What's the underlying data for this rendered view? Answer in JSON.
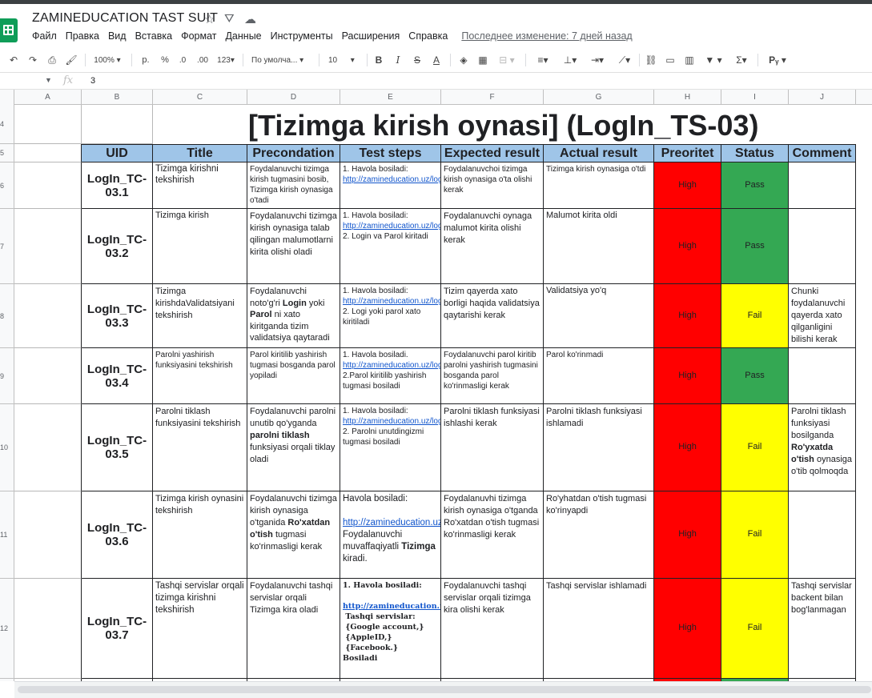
{
  "app": {
    "doc_title": "ZAMINEDUCATION TAST SUIT",
    "menu": [
      "Файл",
      "Правка",
      "Вид",
      "Вставка",
      "Формат",
      "Данные",
      "Инструменты",
      "Расширения",
      "Справка"
    ],
    "last_edit": "Последнее изменение: 7 дней назад"
  },
  "toolbar": {
    "zoom": "100%",
    "currency": "р.",
    "percent": "%",
    "dec_less": ".0",
    "dec_more": ".00",
    "format_123": "123",
    "font": "По умолча...",
    "font_size": "10"
  },
  "formula": {
    "value": "3"
  },
  "columns": [
    "A",
    "B",
    "C",
    "D",
    "E",
    "F",
    "G",
    "H",
    "I",
    "J"
  ],
  "row_numbers": [
    "4",
    "5",
    "6",
    "7",
    "8",
    "9",
    "10",
    "11",
    "12"
  ],
  "sheet": {
    "title": "[Tizimga kirish oynasi] (LogIn_TS-03)",
    "headers": [
      "UID",
      "Title",
      "Precondation",
      "Test steps",
      "Expected result",
      "Actual result",
      "Preoritet",
      "Status",
      "Comment"
    ],
    "rows": [
      {
        "uid": "LogIn_TC-03.1",
        "title": "Tizimga kirishni tekshirish",
        "pre": "Foydalanuvchi tizimga kirish tugmasini bosib, Tizimga kirish oynasiga o'tadi",
        "steps_a": "1. Havola bosiladi: ",
        "link": "http://zamineducation.uz/login",
        "steps_b": "",
        "expected": "Foydalanuvchoi tizimga kirish oynasiga o'ta olishi kerak",
        "actual": "Tizimga kirish oynasiga o'tdi",
        "priority": "High",
        "status": "Pass",
        "comment": ""
      },
      {
        "uid": "LogIn_TC-03.2",
        "title": "Tizimga kirish",
        "pre": "Foydalanuvchi tizimga kirish oynasiga talab qilingan malumotlarni kirita olishi oladi",
        "steps_a": "1. Havola bosiladi: ",
        "link": "http://zamineducation.uz/login",
        "steps_b": "2. Login va Parol kiritadi",
        "expected": "Foydalanuvchi oynaga malumot kirita olishi kerak",
        "actual": "Malumot kirita oldi",
        "priority": "High",
        "status": "Pass",
        "comment": ""
      },
      {
        "uid": "LogIn_TC-03.3",
        "title": "Tizimga kirishdaValidatsiyani tekshirish",
        "pre_a": "Foydalanuvchi noto'g'ri ",
        "pre_b1": "Login",
        "pre_c": " yoki ",
        "pre_b2": "Parol",
        "pre_d": " ni xato kiritganda tizim validatsiya qaytaradi",
        "steps_a": "1. Havola bosiladi: ",
        "link": "http://zamineducation.uz/login",
        "steps_b": "2. Logi yoki parol xato kiritiladi",
        "expected": "Tizim qayerda xato borligi haqida validatsiya qaytarishi kerak",
        "actual": "Validatsiya yo'q",
        "priority": "High",
        "status": "Fail",
        "comment": "Chunki foydalanuvchi qayerda xato qilganligini bilishi kerak"
      },
      {
        "uid": "LogIn_TC-03.4",
        "title": "Parolni yashirish funksiyasini tekshirish",
        "pre": "Parol kiritilib yashirish tugmasi bosganda parol yopiladi",
        "steps_a": " 1. Havola bosiladi. ",
        "link": "http://zamineducation.uz/login",
        "steps_b": "2.Parol kiritilib yashirish tugmasi bosiladi",
        "expected": "Foydalanuvchi parol kiritib parolni yashirish tugmasini bosganda parol ko'rinmasligi kerak",
        "actual": "Parol ko'rinmadi",
        "priority": "High",
        "status": "Pass",
        "comment": ""
      },
      {
        "uid": "LogIn_TC-03.5",
        "title": "Parolni tiklash funksiyasini tekshirish",
        "pre_a": "Foydalanuvchi parolni unutib qo'yganda ",
        "pre_b1": "parolni tiklash",
        "pre_c": " funksiyasi orqali tiklay oladi",
        "steps_a": "1. Havola bosiladi: ",
        "link": "http://zamineducation.uz/login",
        "steps_b": "2. Parolni unutdingizmi tugmasi bosiladi",
        "expected": "Parolni tiklash funksiyasi ishlashi kerak",
        "actual": "Parolni tiklash funksiyasi ishlamadi",
        "priority": "High",
        "status": "Fail",
        "comment_a": "Parolni tiklash funksiyasi bosilganda ",
        "comment_b": "Ro'yxatda o'tish",
        "comment_c": " oynasiga o'tib qolmoqda"
      },
      {
        "uid": "LogIn_TC-03.6",
        "title": "Tizimga kirish oynasini tekshirish",
        "pre_a": "Foydalanuvchi tizimga kirish oynasiga o'tganida ",
        "pre_b1": "Ro'xatdan o'tish",
        "pre_c": " tugmasi ko'rinmasligi kerak",
        "steps_a": "Havola bosiladi:",
        "link": "http://zamineducation.uz/login",
        "steps_b": "Foydalanuvchi muvaffaqiyatli ",
        "steps_bold": "Tizimga",
        "steps_c": " kiradi.",
        "expected": "Foydalanuvhi tizimga kirish oynasiga o'tganda Ro'xatdan o'tish tugmasi ko'rinmasligi kerak",
        "actual": "Ro'yhatdan o'tish tugmasi ko'rinyapdi",
        "priority": "High",
        "status": "Fail",
        "comment": ""
      },
      {
        "uid": "LogIn_TC-03.7",
        "title": "Tashqi servislar orqali tizimga kirishni tekshirish",
        "pre": "Foydalanuvchi tashqi servislar orqali Tizimga kira oladi",
        "steps_a": "1. Havola bosiladi:",
        "link": "http://zamineducation.uz/register",
        "steps_b": "Tashqi servislar:",
        "steps_l1": "{Google account,}",
        "steps_l2": "{AppleID,}",
        "steps_l3": "{Facebook.}",
        "steps_c": "Bosiladi",
        "expected": "Foydalanuvchi tashqi servislar orqali tizimga kira olishi kerak",
        "actual": "Tashqi servislar ishlamadi",
        "priority": "High",
        "status": "Fail",
        "comment": "Tashqi servislar backent bilan bog'lanmagan"
      }
    ]
  },
  "colors": {
    "header_bg": "#9fc5e8",
    "high": "#ff0000",
    "pass": "#34a853",
    "fail": "#ffff00",
    "link": "#1155cc"
  }
}
